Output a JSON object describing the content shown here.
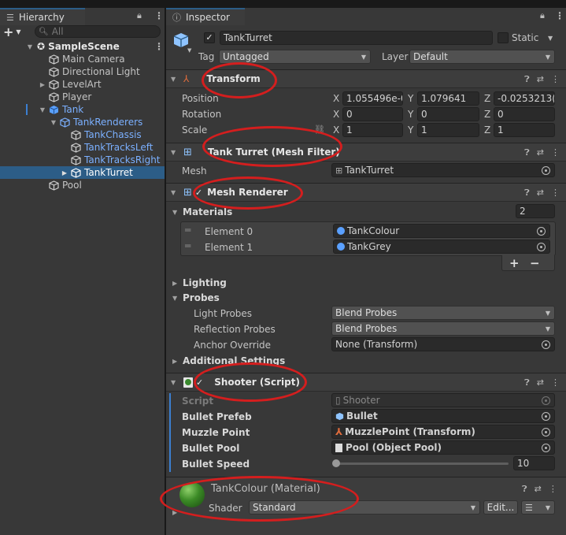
{
  "hierarchy": {
    "tab_label": "Hierarchy",
    "search_placeholder": "All",
    "add_label": "+",
    "items": [
      {
        "label": "SampleScene",
        "bold": true
      },
      {
        "label": "Main Camera"
      },
      {
        "label": "Directional Light"
      },
      {
        "label": "LevelArt"
      },
      {
        "label": "Player"
      },
      {
        "label": "Tank"
      },
      {
        "label": "TankRenderers"
      },
      {
        "label": "TankChassis"
      },
      {
        "label": "TankTracksLeft"
      },
      {
        "label": "TankTracksRight"
      },
      {
        "label": "TankTurret"
      },
      {
        "label": "Pool"
      }
    ]
  },
  "inspector": {
    "tab_label": "Inspector",
    "object_name": "TankTurret",
    "static_label": "Static",
    "tag_label": "Tag",
    "tag_value": "Untagged",
    "layer_label": "Layer",
    "layer_value": "Default",
    "transform": {
      "title": "Transform",
      "position_label": "Position",
      "rotation_label": "Rotation",
      "scale_label": "Scale",
      "position": {
        "x": "1.055496e-0",
        "y": "1.079641",
        "z": "-0.0253213("
      },
      "rotation": {
        "x": "0",
        "y": "0",
        "z": "0"
      },
      "scale": {
        "x": "1",
        "y": "1",
        "z": "1"
      },
      "axis_x": "X",
      "axis_y": "Y",
      "axis_z": "Z"
    },
    "mesh_filter": {
      "title": "Tank Turret (Mesh Filter)",
      "mesh_label": "Mesh",
      "mesh_value": "TankTurret"
    },
    "mesh_renderer": {
      "title": "Mesh Renderer",
      "materials_label": "Materials",
      "materials_count": "2",
      "element0_label": "Element 0",
      "element0_value": "TankColour",
      "element1_label": "Element 1",
      "element1_value": "TankGrey",
      "add_btn": "+",
      "remove_btn": "−",
      "lighting_label": "Lighting",
      "probes_label": "Probes",
      "light_probes_label": "Light Probes",
      "light_probes_value": "Blend Probes",
      "reflection_probes_label": "Reflection Probes",
      "reflection_probes_value": "Blend Probes",
      "anchor_override_label": "Anchor Override",
      "anchor_override_value": "None (Transform)",
      "additional_settings_label": "Additional Settings"
    },
    "shooter": {
      "title": "Shooter (Script)",
      "script_label": "Script",
      "script_value": "Shooter",
      "bullet_prefab_label": "Bullet Prefeb",
      "bullet_prefab_value": "Bullet",
      "muzzle_point_label": "Muzzle Point",
      "muzzle_point_value": "MuzzlePoint (Transform)",
      "bullet_pool_label": "Bullet Pool",
      "bullet_pool_value": "Pool (Object Pool)",
      "bullet_speed_label": "Bullet Speed",
      "bullet_speed_value": "10",
      "bullet_speed_fraction": 0.0
    },
    "material": {
      "title": "TankColour (Material)",
      "shader_label": "Shader",
      "shader_value": "Standard",
      "edit_btn": "Edit..."
    }
  },
  "colors": {
    "accent_selection": "#2c5d87",
    "annotation_red": "#d41e1e",
    "blue_text": "#7bb0ff"
  }
}
